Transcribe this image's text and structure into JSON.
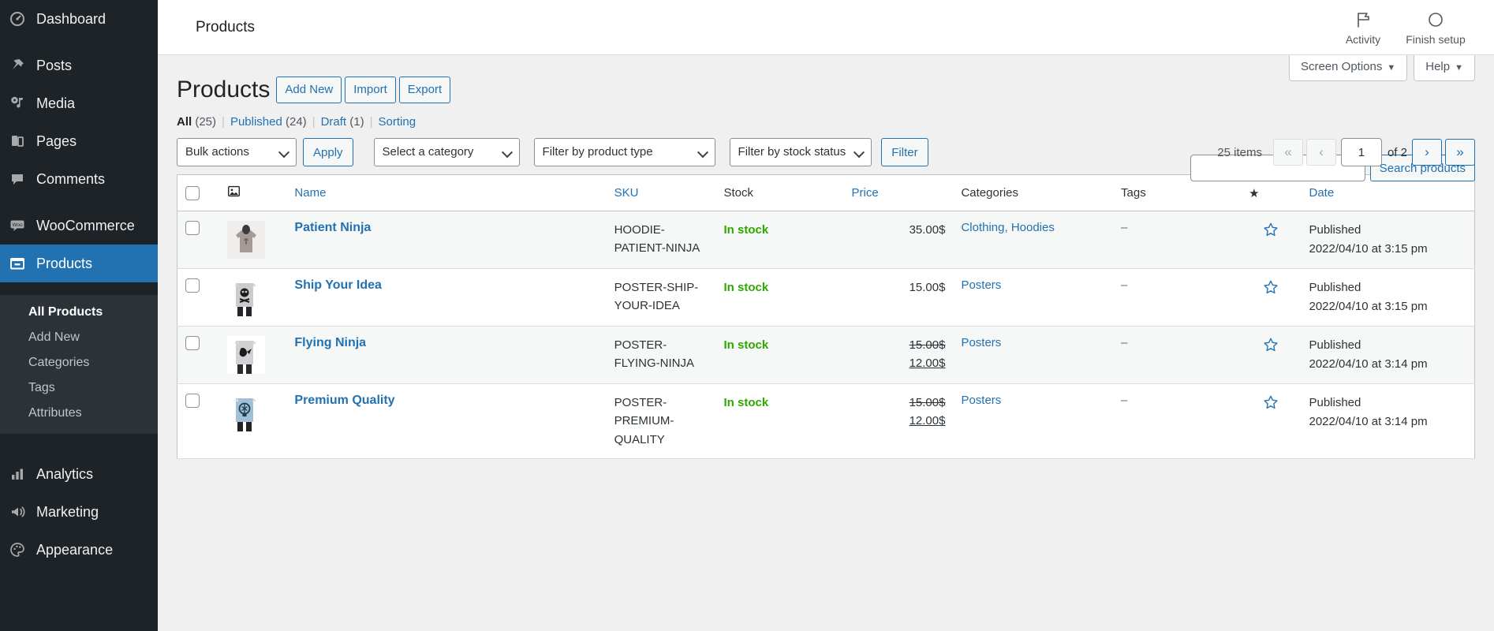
{
  "sidebar": {
    "items": [
      {
        "label": "Dashboard",
        "icon": "dashboard-icon",
        "current": false
      },
      {
        "label": "Posts",
        "icon": "pin-icon",
        "current": false
      },
      {
        "label": "Media",
        "icon": "media-icon",
        "current": false
      },
      {
        "label": "Pages",
        "icon": "pages-icon",
        "current": false
      },
      {
        "label": "Comments",
        "icon": "comments-icon",
        "current": false
      },
      {
        "label": "WooCommerce",
        "icon": "woo-icon",
        "current": false
      },
      {
        "label": "Products",
        "icon": "products-icon",
        "current": true
      },
      {
        "label": "Analytics",
        "icon": "analytics-icon",
        "current": false
      },
      {
        "label": "Marketing",
        "icon": "marketing-icon",
        "current": false
      },
      {
        "label": "Appearance",
        "icon": "appearance-icon",
        "current": false
      }
    ],
    "submenu": [
      {
        "label": "All Products",
        "current": true
      },
      {
        "label": "Add New",
        "current": false
      },
      {
        "label": "Categories",
        "current": false
      },
      {
        "label": "Tags",
        "current": false
      },
      {
        "label": "Attributes",
        "current": false
      }
    ]
  },
  "woo_header": {
    "title": "Products",
    "activity_label": "Activity",
    "activity_icon": "flag-icon",
    "finish_setup_label": "Finish setup",
    "finish_setup_icon": "circle-progress-icon"
  },
  "screen_meta": {
    "screen_options_label": "Screen Options",
    "help_label": "Help",
    "caret_glyph": "▼"
  },
  "page": {
    "heading": "Products",
    "actions": [
      {
        "label": "Add New"
      },
      {
        "label": "Import"
      },
      {
        "label": "Export"
      }
    ]
  },
  "status_links": [
    {
      "label": "All",
      "count": "(25)",
      "current": true
    },
    {
      "label": "Published",
      "count": "(24)",
      "current": false
    },
    {
      "label": "Draft",
      "count": "(1)",
      "current": false
    },
    {
      "label": "Sorting",
      "count": "",
      "current": false
    }
  ],
  "search": {
    "value": "",
    "placeholder": "",
    "button_label": "Search products"
  },
  "tablenav": {
    "bulk_actions_label": "Bulk actions",
    "apply_label": "Apply",
    "category_label": "Select a category",
    "product_type_label": "Filter by product type",
    "stock_status_label": "Filter by stock status",
    "filter_label": "Filter",
    "displaying_num": "25 items",
    "first_page_glyph": "«",
    "prev_page_glyph": "‹",
    "next_page_glyph": "›",
    "last_page_glyph": "»",
    "current_page": "1",
    "total_pages_label": "of 2"
  },
  "table": {
    "columns": [
      {
        "key": "cb",
        "label": "",
        "sortable": false
      },
      {
        "key": "thumb",
        "label": "",
        "sortable": false
      },
      {
        "key": "name",
        "label": "Name",
        "sortable": true
      },
      {
        "key": "sku",
        "label": "SKU",
        "sortable": true
      },
      {
        "key": "stock",
        "label": "Stock",
        "sortable": false
      },
      {
        "key": "price",
        "label": "Price",
        "sortable": true
      },
      {
        "key": "categories",
        "label": "Categories",
        "sortable": false
      },
      {
        "key": "tags",
        "label": "Tags",
        "sortable": false
      },
      {
        "key": "featured",
        "label": "★",
        "sortable": false
      },
      {
        "key": "date",
        "label": "Date",
        "sortable": true
      }
    ],
    "rows": [
      {
        "name": "Patient Ninja",
        "sku": "HOODIE-PATIENT-NINJA",
        "stock": "In stock",
        "price": "35.00$",
        "price_regular": "",
        "price_sale": "",
        "categories": "Clothing, Hoodies",
        "tags": "–",
        "featured": "star-outline-icon",
        "date_status": "Published",
        "date_value": "2022/04/10 at 3:15 pm",
        "thumb": "hoodie-grey"
      },
      {
        "name": "Ship Your Idea",
        "sku": "POSTER-SHIP-YOUR-IDEA",
        "stock": "In stock",
        "price": "15.00$",
        "price_regular": "",
        "price_sale": "",
        "categories": "Posters",
        "tags": "–",
        "featured": "star-outline-icon",
        "date_status": "Published",
        "date_value": "2022/04/10 at 3:15 pm",
        "thumb": "poster-skull"
      },
      {
        "name": "Flying Ninja",
        "sku": "POSTER-FLYING-NINJA",
        "stock": "In stock",
        "price": "",
        "price_regular": "15.00$",
        "price_sale": "12.00$",
        "categories": "Posters",
        "tags": "–",
        "featured": "star-outline-icon",
        "date_status": "Published",
        "date_value": "2022/04/10 at 3:14 pm",
        "thumb": "poster-ninja"
      },
      {
        "name": "Premium Quality",
        "sku": "POSTER-PREMIUM-QUALITY",
        "stock": "In stock",
        "price": "",
        "price_regular": "15.00$",
        "price_sale": "12.00$",
        "categories": "Posters",
        "tags": "–",
        "featured": "star-outline-icon",
        "date_status": "Published",
        "date_value": "2022/04/10 at 3:14 pm",
        "thumb": "poster-bulb"
      }
    ]
  },
  "colors": {
    "accent_blue": "#2271b1",
    "sidebar_bg": "#1d2327",
    "submenu_bg": "#2c3338",
    "instock_green": "#2ea800",
    "page_bg": "#f0f0f1"
  }
}
